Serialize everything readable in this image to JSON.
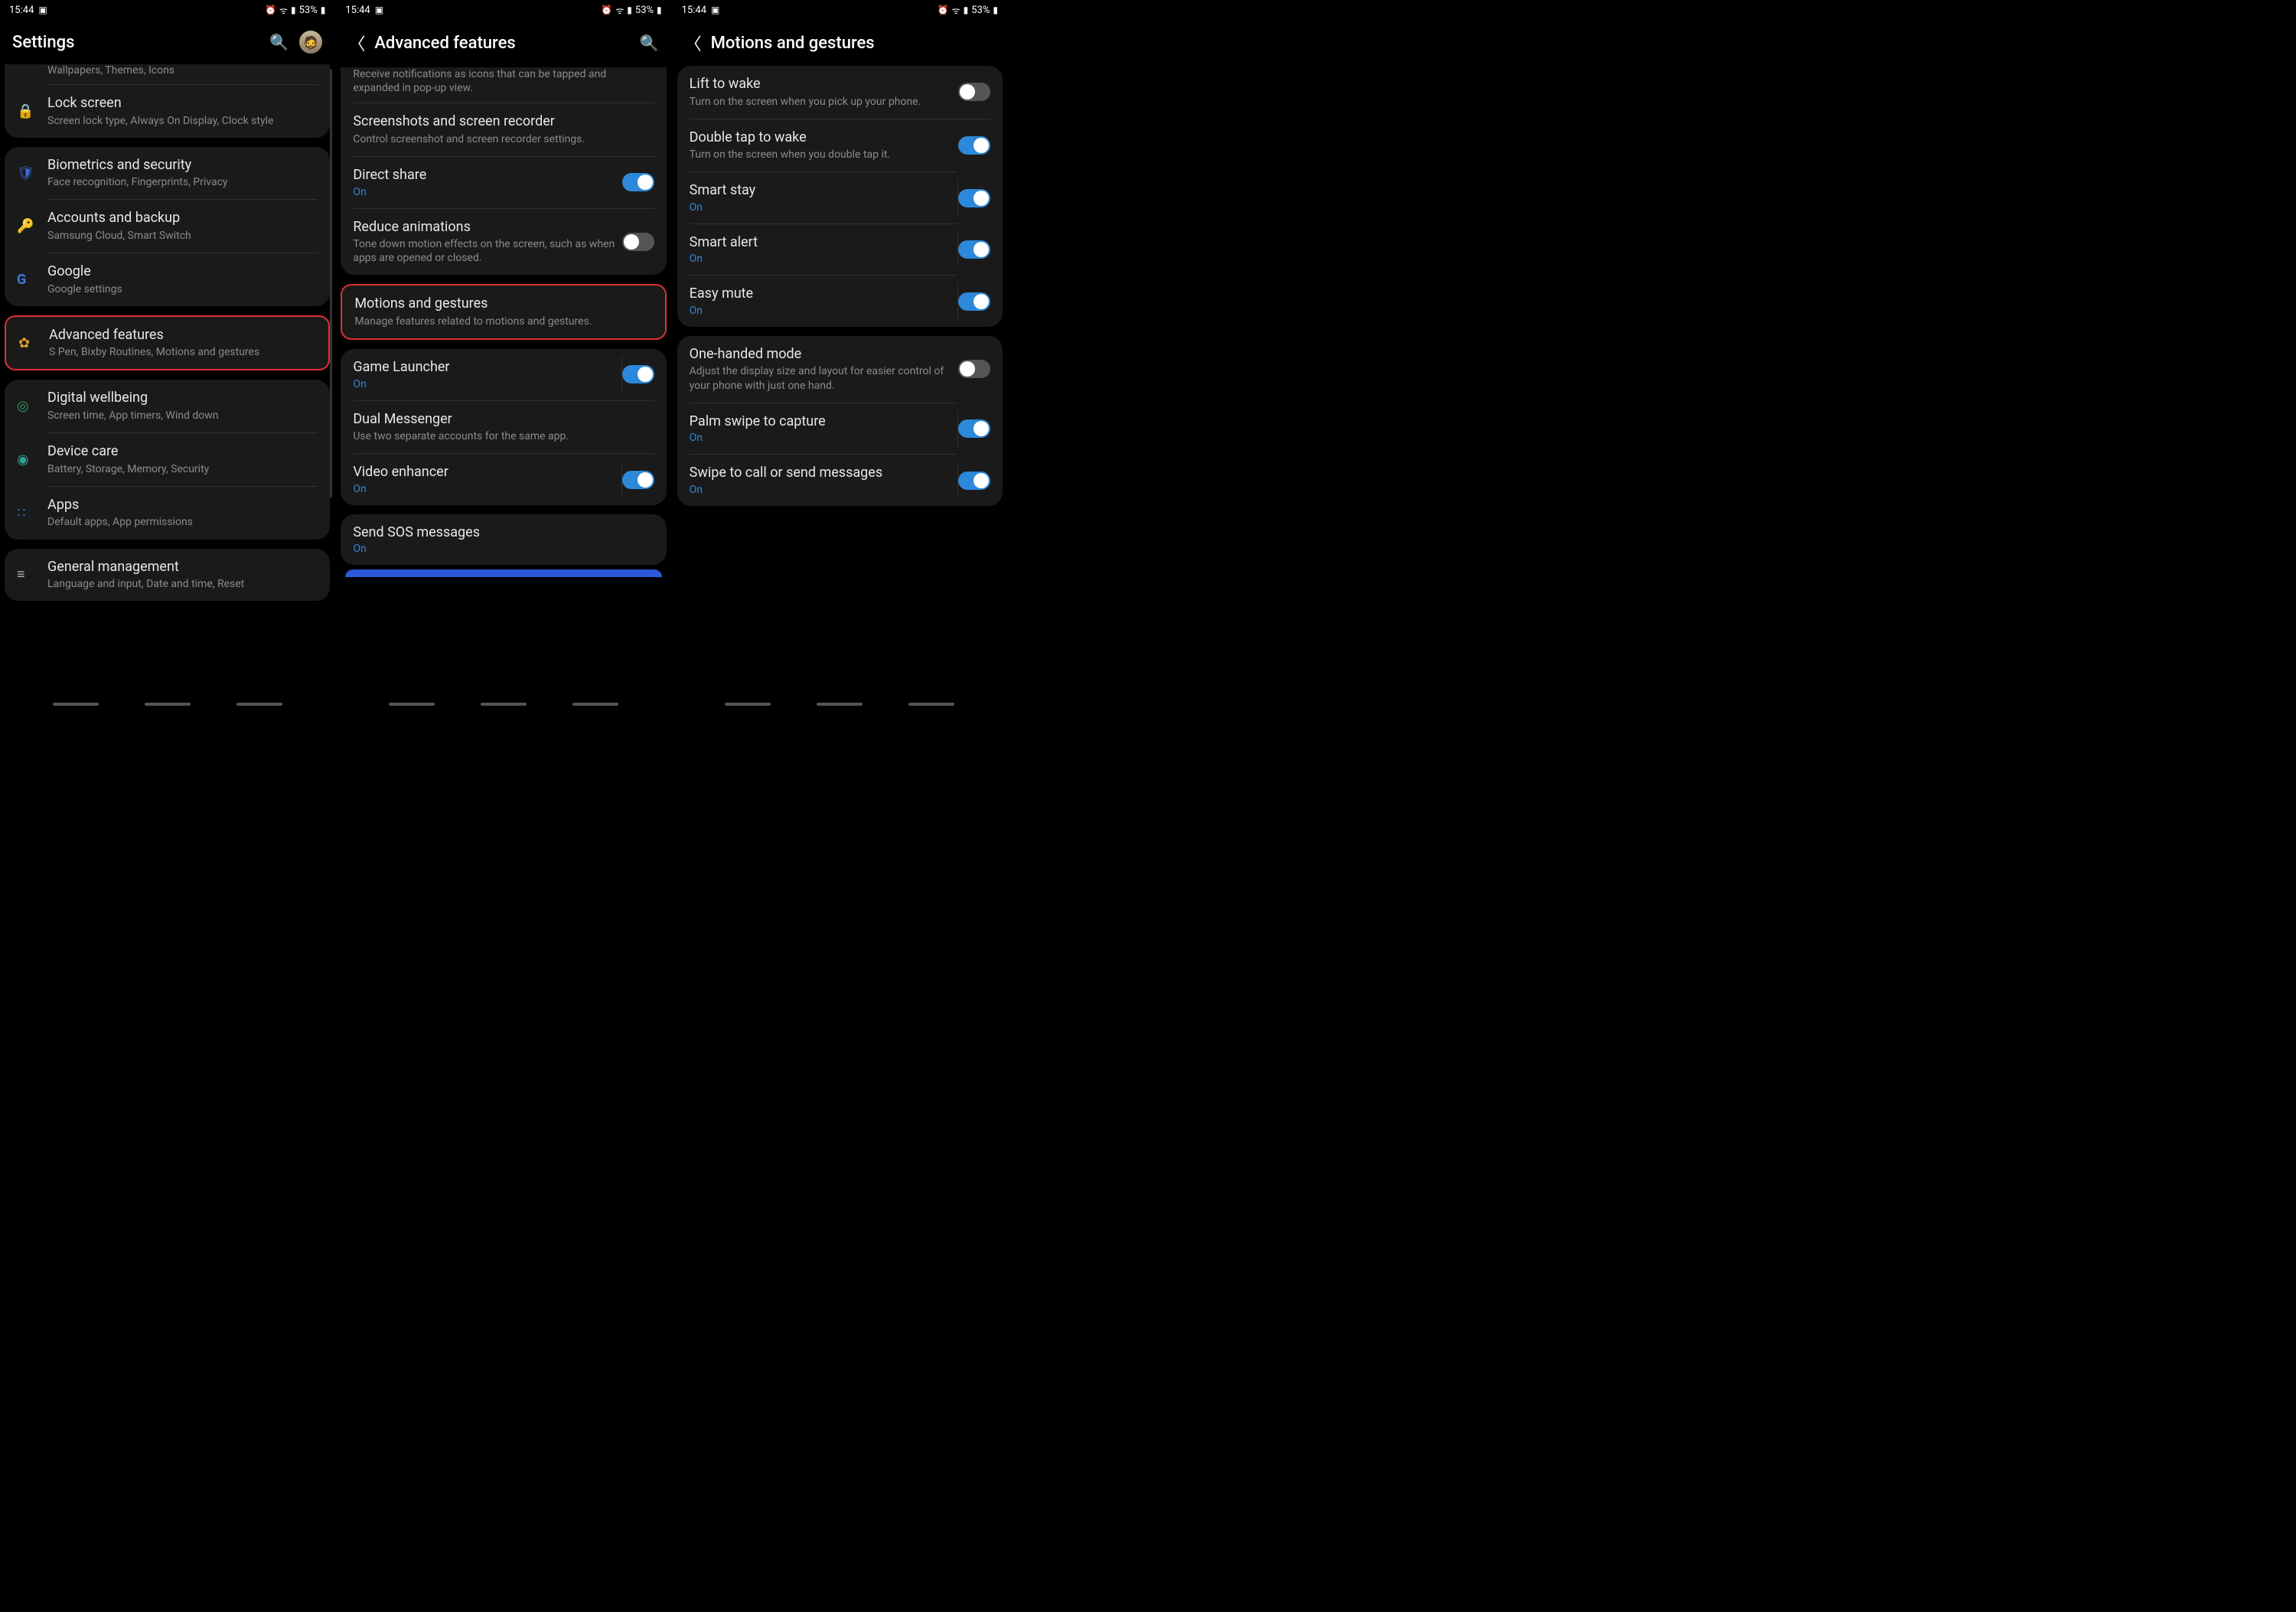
{
  "status": {
    "time": "15:44",
    "battery": "53%"
  },
  "panel1": {
    "title": "Settings",
    "partial_top": "Wallpapers, Themes, Icons",
    "items": [
      {
        "icon": "🔒",
        "icon_color": "#8a6cf0",
        "title": "Lock screen",
        "sub": "Screen lock type, Always On Display, Clock style"
      },
      {
        "icon": "🛡",
        "icon_color": "#3a6cd0",
        "title": "Biometrics and security",
        "sub": "Face recognition, Fingerprints, Privacy"
      },
      {
        "icon": "🔑",
        "icon_color": "#e0a030",
        "title": "Accounts and backup",
        "sub": "Samsung Cloud, Smart Switch"
      },
      {
        "icon": "G",
        "icon_color": "#3a7ce0",
        "title": "Google",
        "sub": "Google settings"
      },
      {
        "icon": "✿",
        "icon_color": "#e0a030",
        "title": "Advanced features",
        "sub": "S Pen, Bixby Routines, Motions and gestures"
      },
      {
        "icon": "◎",
        "icon_color": "#30a060",
        "title": "Digital wellbeing",
        "sub": "Screen time, App timers, Wind down"
      },
      {
        "icon": "◉",
        "icon_color": "#30a090",
        "title": "Device care",
        "sub": "Battery, Storage, Memory, Security"
      },
      {
        "icon": "∷",
        "icon_color": "#3a7ce0",
        "title": "Apps",
        "sub": "Default apps, App permissions"
      },
      {
        "icon": "≡",
        "icon_color": "#bbb",
        "title": "General management",
        "sub": "Language and input, Date and time, Reset"
      }
    ]
  },
  "panel2": {
    "title": "Advanced features",
    "partial_top": "Receive notifications as icons that can be tapped and expanded in pop-up view.",
    "items": [
      {
        "title": "Screenshots and screen recorder",
        "sub": "Control screenshot and screen recorder settings."
      },
      {
        "title": "Direct share",
        "status": "On",
        "toggle": "on"
      },
      {
        "title": "Reduce animations",
        "sub": "Tone down motion effects on the screen, such as when apps are opened or closed.",
        "toggle": "off"
      },
      {
        "title": "Motions and gestures",
        "sub": "Manage features related to motions and gestures."
      },
      {
        "title": "Game Launcher",
        "status": "On",
        "toggle": "on"
      },
      {
        "title": "Dual Messenger",
        "sub": "Use two separate accounts for the same app."
      },
      {
        "title": "Video enhancer",
        "status": "On",
        "toggle": "on"
      },
      {
        "title": "Send SOS messages",
        "status": "On"
      }
    ]
  },
  "panel3": {
    "title": "Motions and gestures",
    "items": [
      {
        "title": "Lift to wake",
        "sub": "Turn on the screen when you pick up your phone.",
        "toggle": "off"
      },
      {
        "title": "Double tap to wake",
        "sub": "Turn on the screen when you double tap it.",
        "toggle": "on"
      },
      {
        "title": "Smart stay",
        "status": "On",
        "toggle": "on",
        "divider": true
      },
      {
        "title": "Smart alert",
        "status": "On",
        "toggle": "on",
        "divider": true
      },
      {
        "title": "Easy mute",
        "status": "On",
        "toggle": "on",
        "divider": true
      },
      {
        "title": "One-handed mode",
        "sub": "Adjust the display size and layout for easier control of your phone with just one hand.",
        "toggle": "off"
      },
      {
        "title": "Palm swipe to capture",
        "status": "On",
        "toggle": "on",
        "divider": true
      },
      {
        "title": "Swipe to call or send messages",
        "status": "On",
        "toggle": "on",
        "divider": true
      }
    ]
  }
}
